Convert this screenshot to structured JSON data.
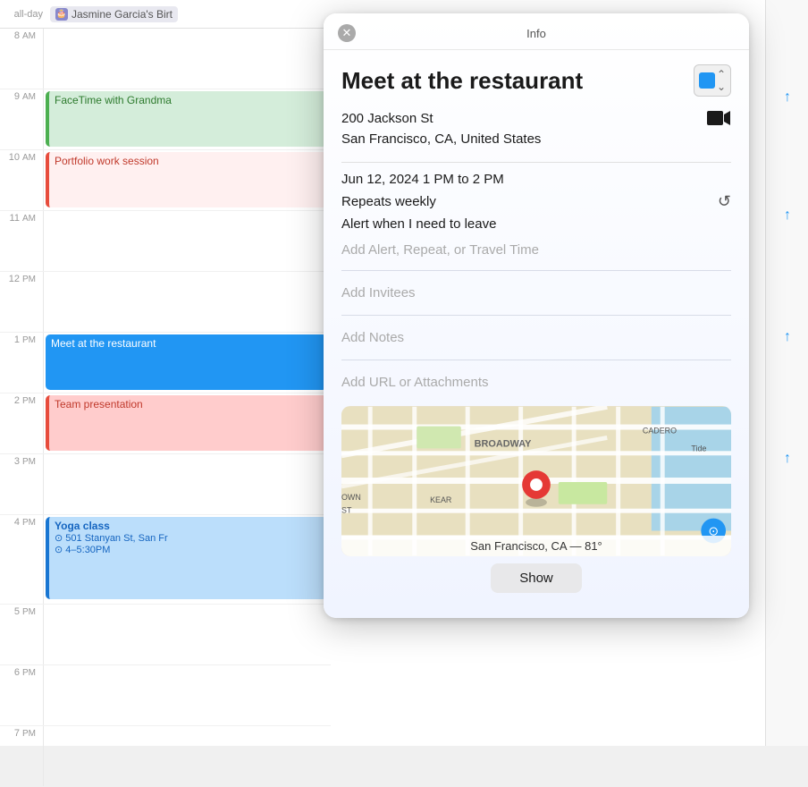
{
  "popup": {
    "title": "Info",
    "close_label": "✕",
    "event_title": "Meet at the restaurant",
    "location_line1": "200 Jackson St",
    "location_line2": "San Francisco, CA, United States",
    "date_time": "Jun 12, 2024  1 PM to 2 PM",
    "repeat": "Repeats weekly",
    "alert": "Alert when I need to leave",
    "add_alert": "Add Alert, Repeat, or Travel Time",
    "add_invitees": "Add Invitees",
    "add_notes": "Add Notes",
    "add_url": "Add URL or Attachments",
    "map_location": "San Francisco, CA — 81°",
    "show_button": "Show"
  },
  "calendar": {
    "all_day_label": "all-day",
    "all_day_event": "Jasmine Garcia's Birt",
    "time_slots": [
      {
        "label": "8 AM"
      },
      {
        "label": "9 AM"
      },
      {
        "label": "10 AM"
      },
      {
        "label": "11 AM"
      },
      {
        "label": "12 PM"
      },
      {
        "label": "1 PM"
      },
      {
        "label": "2 PM"
      },
      {
        "label": "3 PM"
      },
      {
        "label": "4 PM"
      },
      {
        "label": "5 PM"
      },
      {
        "label": "6 PM"
      },
      {
        "label": "7 PM"
      }
    ],
    "events": {
      "facetime": "FaceTime with Grandma",
      "portfolio": "Portfolio work session",
      "restaurant": "Meet at the restaurant",
      "team": "Team presentation",
      "yoga": "Yoga class",
      "yoga_location": "501 Stanyan St, San Fr",
      "yoga_time": "4–5:30PM"
    }
  },
  "icons": {
    "birthday": "🎂",
    "video": "📹",
    "repeat": "↺",
    "location": "⊙",
    "clock": "⊙"
  }
}
